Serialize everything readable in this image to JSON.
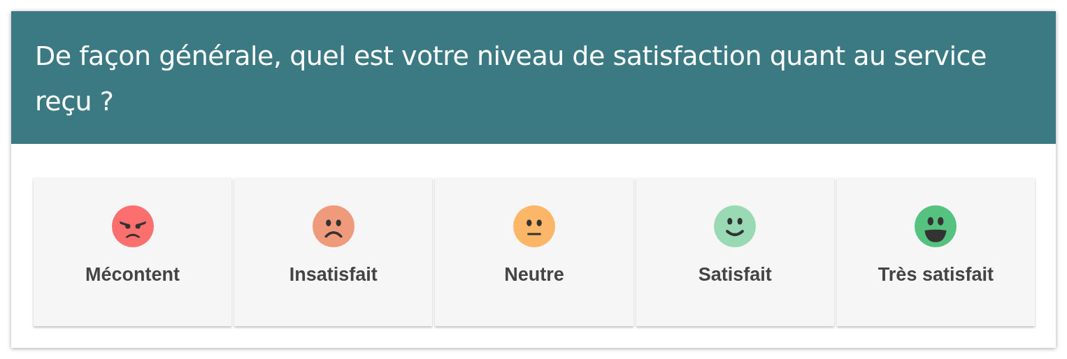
{
  "question": "De façon générale, quel est votre niveau de satisfaction quant au service reçu ?",
  "options": [
    {
      "label": "Mécontent",
      "kind": "angry",
      "color": "#fc6f6f"
    },
    {
      "label": "Insatisfait",
      "kind": "sad",
      "color": "#ee9a7b"
    },
    {
      "label": "Neutre",
      "kind": "neutral",
      "color": "#fcb667"
    },
    {
      "label": "Satisfait",
      "kind": "smile",
      "color": "#99d9b4"
    },
    {
      "label": "Très satisfait",
      "kind": "grin",
      "color": "#55c27f"
    }
  ]
}
